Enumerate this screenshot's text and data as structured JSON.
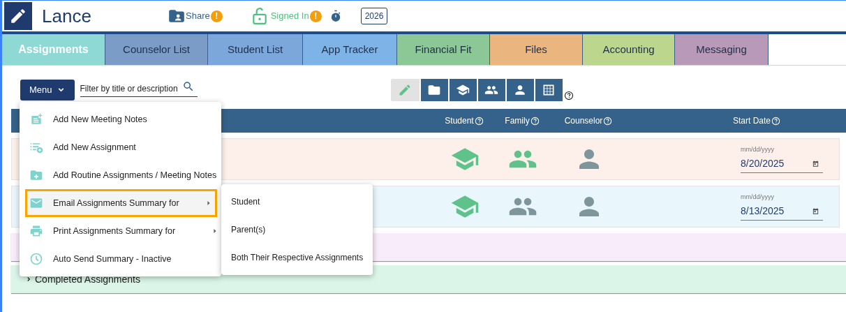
{
  "header": {
    "title": "Lance",
    "share": {
      "label": "Share",
      "alert": "!"
    },
    "signin": {
      "label": "Signed In",
      "alert": "!"
    },
    "year": "2026"
  },
  "tabs": [
    {
      "label": "Assignments",
      "selected": true,
      "color": "#8ed9d4"
    },
    {
      "label": "Counselor List",
      "selected": false,
      "color": "#7a9cc6"
    },
    {
      "label": "Student List",
      "selected": false,
      "color": "#7ba7db"
    },
    {
      "label": "App Tracker",
      "selected": false,
      "color": "#7eb3e8"
    },
    {
      "label": "Financial Fit",
      "selected": false,
      "color": "#8cc796"
    },
    {
      "label": "Files",
      "selected": false,
      "color": "#ebb57f"
    },
    {
      "label": "Accounting",
      "selected": false,
      "color": "#bcd68e"
    },
    {
      "label": "Messaging",
      "selected": false,
      "color": "#b89ab8"
    }
  ],
  "toolbar": {
    "menu_label": "Menu",
    "filter_placeholder": "Filter by title or description",
    "view_buttons": [
      {
        "selected": true
      },
      {
        "selected": false
      },
      {
        "selected": false
      },
      {
        "selected": false
      },
      {
        "selected": false
      },
      {
        "selected": false
      }
    ]
  },
  "table": {
    "columns": [
      "Student",
      "Family",
      "Counselor",
      "Start Date"
    ],
    "rows": [
      {
        "kind": "assignment",
        "color": "#fdf0eb",
        "student_on": true,
        "family_on": true,
        "counselor_on": false,
        "date_label": "mm/dd/yyyy",
        "start_date": "8/20/2025"
      },
      {
        "kind": "assignment",
        "color": "#e9f7fd",
        "student_on": true,
        "family_on": false,
        "counselor_on": false,
        "date_label": "mm/dd/yyyy",
        "start_date": "8/13/2025"
      },
      {
        "kind": "group",
        "color": "#f8ebfa"
      },
      {
        "kind": "group",
        "color": "#dbf5e8",
        "label": "Completed Assignments"
      }
    ]
  },
  "menu": {
    "items": [
      {
        "label": "Add New Meeting Notes",
        "has_submenu": false,
        "selected": false
      },
      {
        "label": "Add New Assignment",
        "has_submenu": false,
        "selected": false
      },
      {
        "label": "Add Routine Assignments / Meeting Notes",
        "has_submenu": false,
        "selected": false
      },
      {
        "label": "Email Assignments Summary for",
        "has_submenu": true,
        "selected": true
      },
      {
        "label": "Print Assignments Summary for",
        "has_submenu": true,
        "selected": false
      },
      {
        "label": "Auto Send Summary - Inactive",
        "has_submenu": false,
        "selected": false
      }
    ],
    "submenu": [
      "Student",
      "Parent(s)",
      "Both Their Respective Assignments"
    ]
  }
}
